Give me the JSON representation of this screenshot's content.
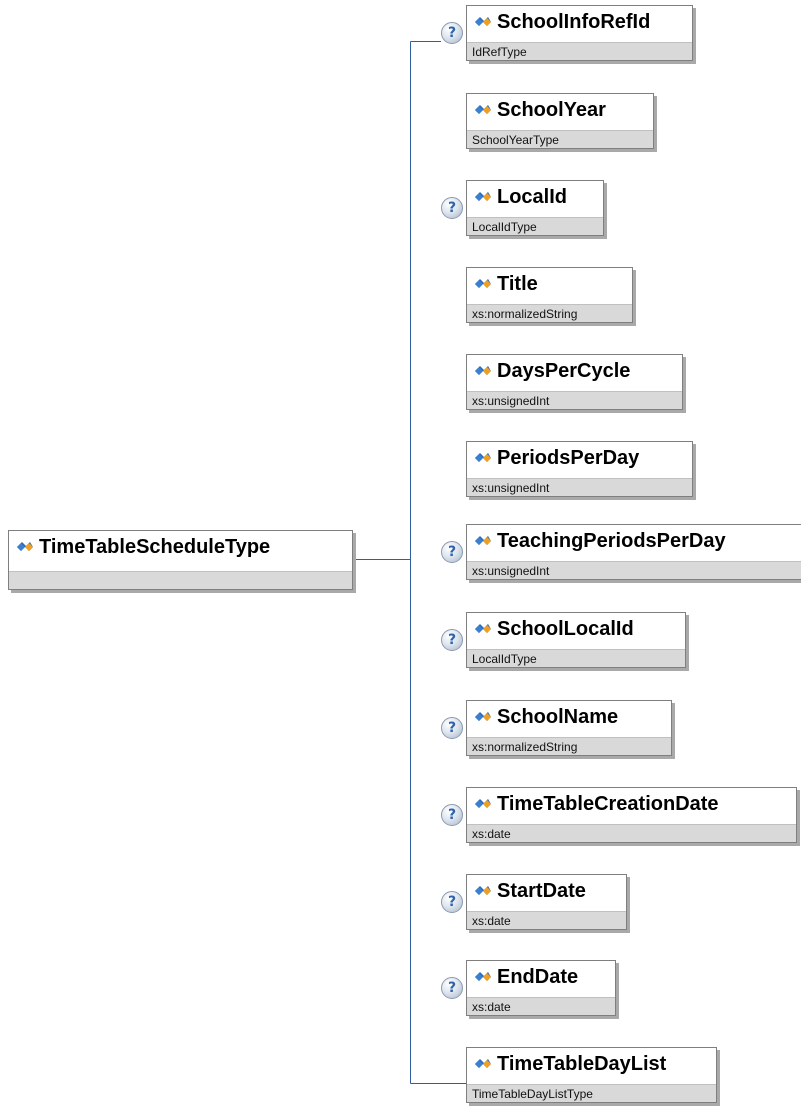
{
  "root": {
    "name": "TimeTableScheduleType",
    "type": ""
  },
  "children": [
    {
      "name": "SchoolInfoRefId",
      "type": "IdRefType",
      "optional": true
    },
    {
      "name": "SchoolYear",
      "type": "SchoolYearType",
      "optional": false
    },
    {
      "name": "LocalId",
      "type": "LocalIdType",
      "optional": true
    },
    {
      "name": "Title",
      "type": "xs:normalizedString",
      "optional": false
    },
    {
      "name": "DaysPerCycle",
      "type": "xs:unsignedInt",
      "optional": false
    },
    {
      "name": "PeriodsPerDay",
      "type": "xs:unsignedInt",
      "optional": false
    },
    {
      "name": "TeachingPeriodsPerDay",
      "type": "xs:unsignedInt",
      "optional": true
    },
    {
      "name": "SchoolLocalId",
      "type": "LocalIdType",
      "optional": true
    },
    {
      "name": "SchoolName",
      "type": "xs:normalizedString",
      "optional": true
    },
    {
      "name": "TimeTableCreationDate",
      "type": "xs:date",
      "optional": true
    },
    {
      "name": "StartDate",
      "type": "xs:date",
      "optional": true
    },
    {
      "name": "EndDate",
      "type": "xs:date",
      "optional": true
    },
    {
      "name": "TimeTableDayList",
      "type": "TimeTableDayListType",
      "optional": false
    }
  ],
  "optional_marker": "?",
  "colors": {
    "connector": "#2f5f9e",
    "type_bar": "#d9d9d9",
    "border": "#7f7f7f"
  }
}
